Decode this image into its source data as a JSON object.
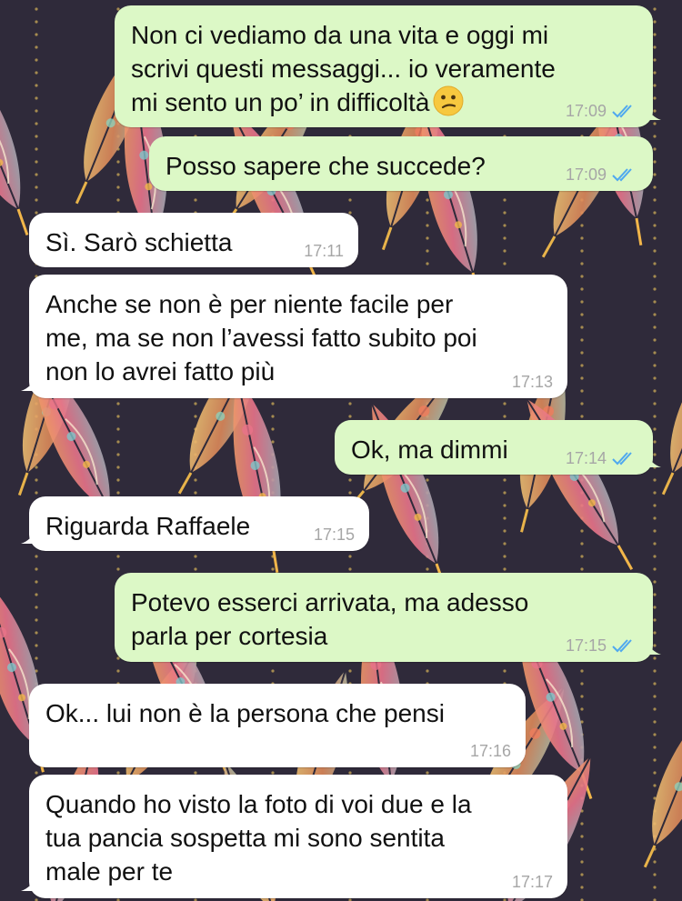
{
  "theme": {
    "outgoing_bubble": "#dcf8c6",
    "incoming_bubble": "#ffffff",
    "background": "#2f2a3a",
    "read_tick": "#4fa8ef"
  },
  "messages": [
    {
      "direction": "outgoing",
      "text": "Non ci vediamo da una vita e oggi mi\nscrivi questi messaggi... io veramente\nmi sento un po’ in difficoltà",
      "emoji": "confused-face",
      "time": "17:09",
      "status": "read"
    },
    {
      "direction": "outgoing",
      "text": "Posso sapere che succede?",
      "time": "17:09",
      "status": "read"
    },
    {
      "direction": "incoming",
      "text": "Sì. Sarò schietta",
      "time": "17:11"
    },
    {
      "direction": "incoming",
      "text": "Anche se non è per niente facile per\nme, ma se non l’avessi fatto subito poi\nnon lo avrei fatto più",
      "time": "17:13"
    },
    {
      "direction": "outgoing",
      "text": "Ok, ma dimmi",
      "time": "17:14",
      "status": "read"
    },
    {
      "direction": "incoming",
      "text": "Riguarda Raffaele",
      "time": "17:15"
    },
    {
      "direction": "outgoing",
      "text": "Potevo esserci arrivata, ma adesso\nparla per cortesia",
      "time": "17:15",
      "status": "read"
    },
    {
      "direction": "incoming",
      "text": "Ok... lui non è la persona che pensi",
      "time": "17:16"
    },
    {
      "direction": "incoming",
      "text": "Quando ho visto la foto di voi due e la\ntua pancia sospetta mi sono sentita\nmale per te",
      "time": "17:17"
    }
  ]
}
